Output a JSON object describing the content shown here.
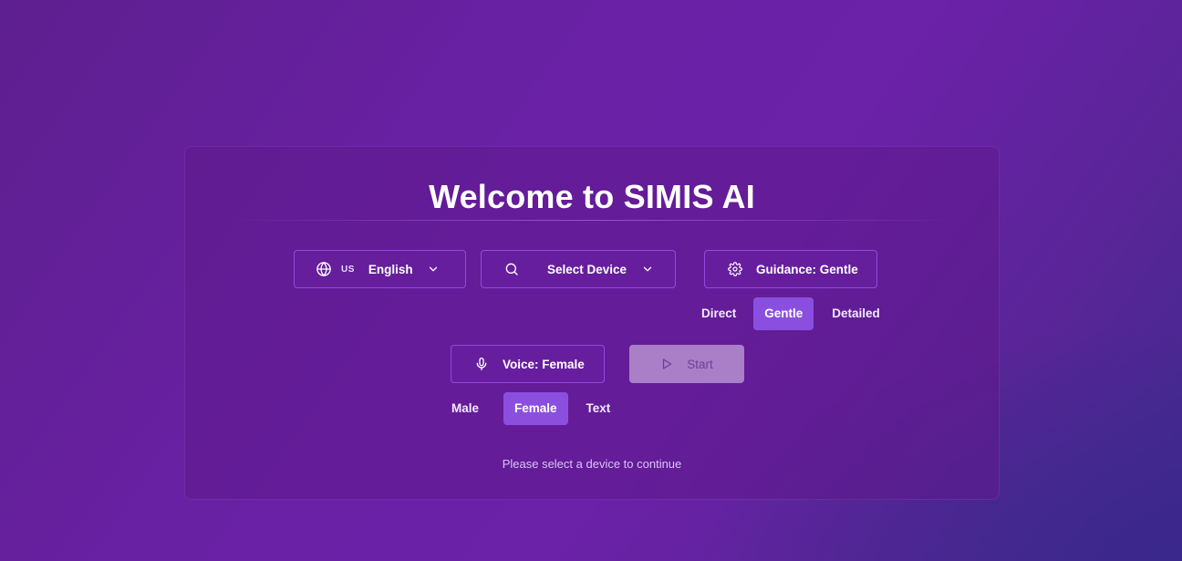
{
  "card": {
    "title": "Welcome to SIMIS AI",
    "hint": "Please select a device to continue"
  },
  "language": {
    "flag": "US",
    "label": "English",
    "icon": "globe-icon"
  },
  "device": {
    "label": "Select Device",
    "icon": "search-icon"
  },
  "guidance": {
    "label": "Guidance: Gentle",
    "icon": "gear-icon",
    "options": [
      "Direct",
      "Gentle",
      "Detailed"
    ],
    "selected": "Gentle"
  },
  "voice": {
    "label": "Voice: Female",
    "icon": "microphone-icon",
    "options": [
      "Male",
      "Female",
      "Text"
    ],
    "selected": "Female"
  },
  "start": {
    "label": "Start",
    "icon": "play-icon",
    "enabled": false
  },
  "colors": {
    "accent": "#8b4fe0",
    "border": "#a855f7",
    "start_disabled": "#c8aadc"
  }
}
